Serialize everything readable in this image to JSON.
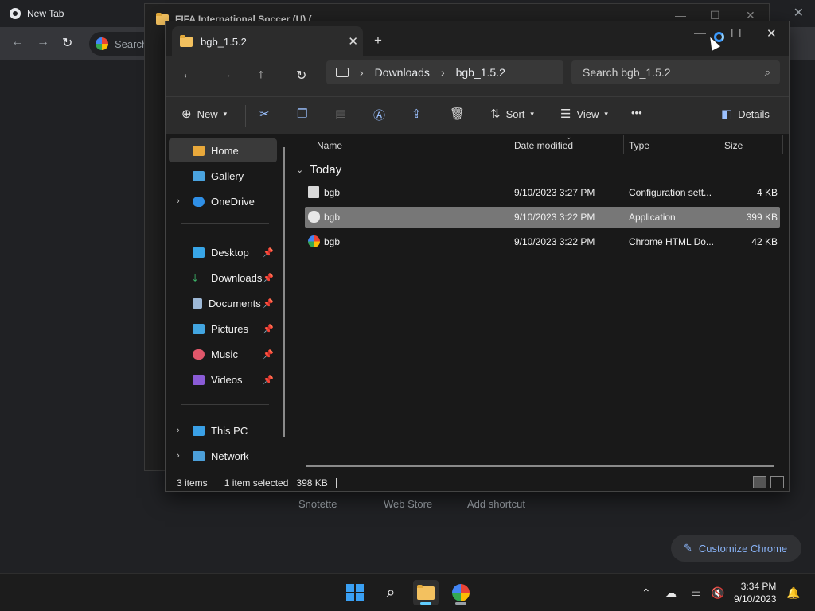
{
  "chrome": {
    "tab_title": "New Tab",
    "search_placeholder": "Search",
    "shortcuts": [
      "Snotette",
      "Web Store",
      "Add shortcut"
    ],
    "customize_label": "Customize Chrome"
  },
  "background_window": {
    "title": "FIFA International Soccer (U) (..."
  },
  "explorer": {
    "tab_title": "bgb_1.5.2",
    "breadcrumb": [
      "Downloads",
      "bgb_1.5.2"
    ],
    "search_placeholder": "Search bgb_1.5.2",
    "commands": {
      "new": "New",
      "sort": "Sort",
      "view": "View",
      "more": "•••",
      "details": "Details"
    },
    "nav_items": [
      {
        "label": "Home",
        "icon": "home-icon"
      },
      {
        "label": "Gallery",
        "icon": "gallery-icon"
      },
      {
        "label": "OneDrive",
        "icon": "cloud-icon"
      },
      {
        "label": "Desktop",
        "icon": "desktop-icon"
      },
      {
        "label": "Downloads",
        "icon": "download-icon"
      },
      {
        "label": "Documents",
        "icon": "document-icon"
      },
      {
        "label": "Pictures",
        "icon": "pictures-icon"
      },
      {
        "label": "Music",
        "icon": "music-icon"
      },
      {
        "label": "Videos",
        "icon": "video-icon"
      },
      {
        "label": "This PC",
        "icon": "pc-icon"
      },
      {
        "label": "Network",
        "icon": "network-icon"
      }
    ],
    "columns": {
      "name": "Name",
      "date": "Date modified",
      "type": "Type",
      "size": "Size"
    },
    "group_label": "Today",
    "files": [
      {
        "name": "bgb",
        "date": "9/10/2023 3:27 PM",
        "type": "Configuration sett...",
        "size": "4 KB",
        "icon": "config-file-icon"
      },
      {
        "name": "bgb",
        "date": "9/10/2023 3:22 PM",
        "type": "Application",
        "size": "399 KB",
        "icon": "application-icon"
      },
      {
        "name": "bgb",
        "date": "9/10/2023 3:22 PM",
        "type": "Chrome HTML Do...",
        "size": "42 KB",
        "icon": "chrome-html-icon"
      }
    ],
    "status": {
      "count": "3 items",
      "selection": "1 item selected",
      "size": "398 KB"
    }
  },
  "taskbar": {
    "time": "3:34 PM",
    "date": "9/10/2023"
  }
}
